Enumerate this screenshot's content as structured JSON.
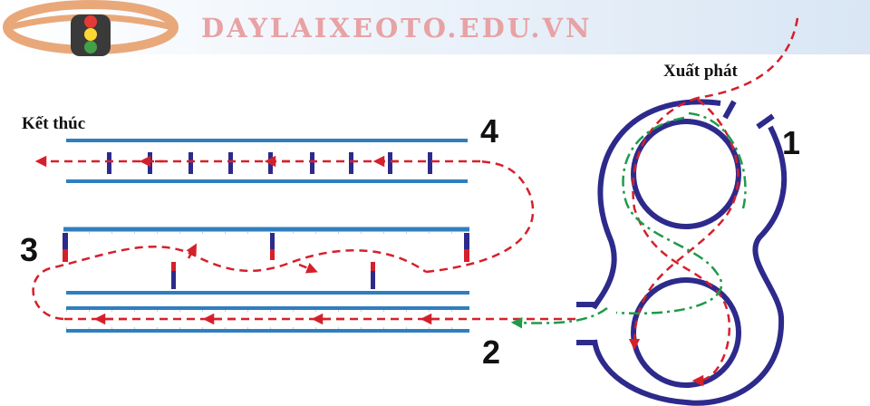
{
  "header": {
    "site_title": "DAYLAIXEOTO.EDU.VN"
  },
  "labels": {
    "start": "Xuất phát",
    "finish": "Kết thúc",
    "n1": "1",
    "n2": "2",
    "n3": "3",
    "n4": "4"
  },
  "colors": {
    "road": "#2f7fbf",
    "figure8": "#2d2a8c",
    "path_red": "#d5202b",
    "path_green": "#1f9a4a",
    "banner_text": "#e8a2a4",
    "logo": "#e9a87a"
  },
  "icons": {
    "logo": "steering-wheel-traffic-light-logo"
  }
}
